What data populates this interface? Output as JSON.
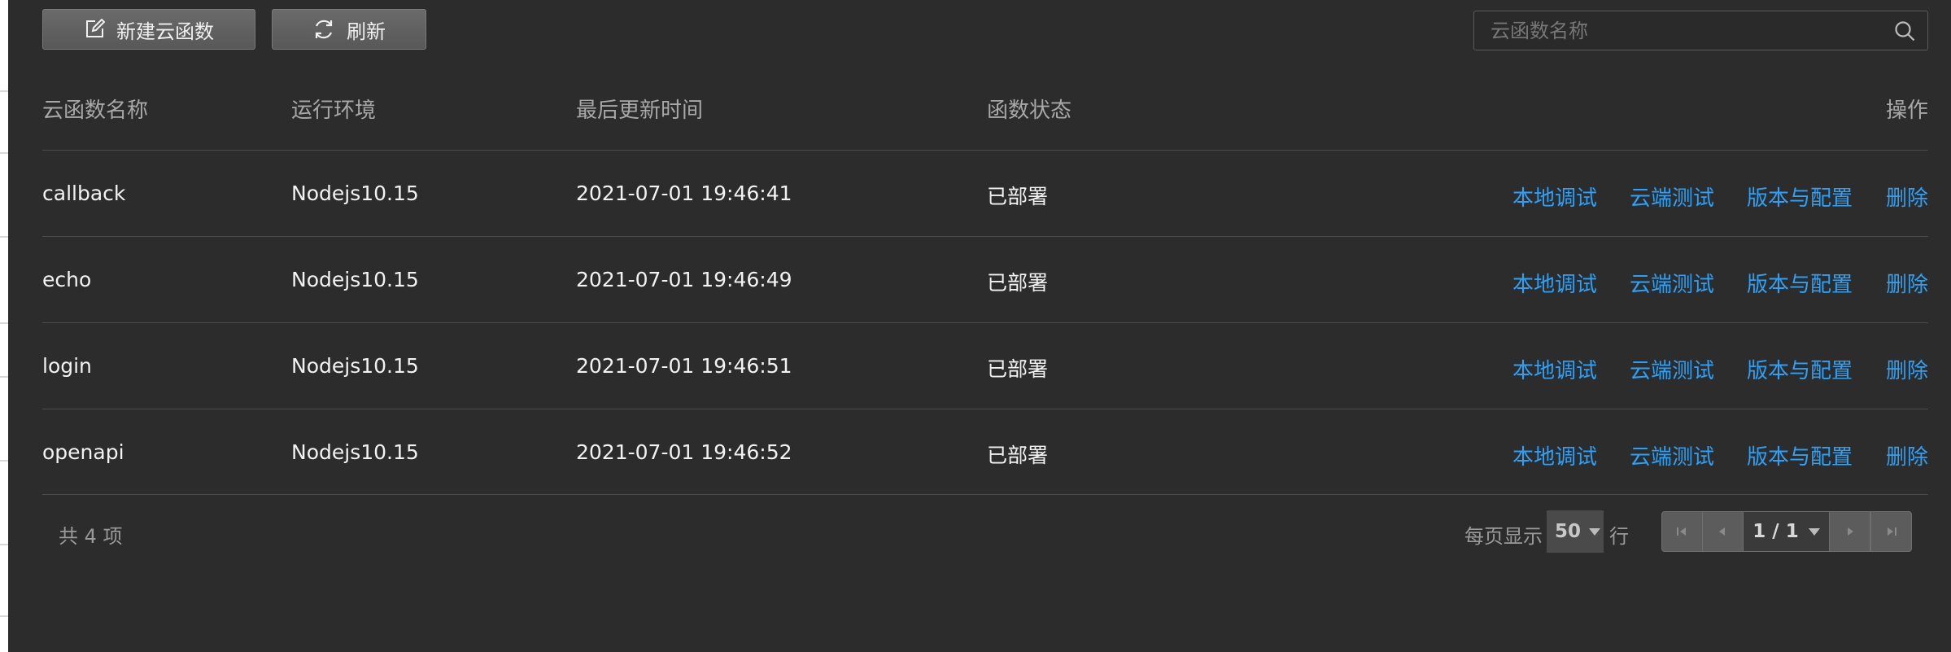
{
  "toolbar": {
    "new_label": "新建云函数",
    "refresh_label": "刷新",
    "search_placeholder": "云函数名称"
  },
  "table": {
    "headers": {
      "name": "云函数名称",
      "runtime": "运行环境",
      "updated": "最后更新时间",
      "status": "函数状态",
      "actions": "操作"
    },
    "rows": [
      {
        "name": "callback",
        "runtime": "Nodejs10.15",
        "updated": "2021-07-01 19:46:41",
        "status": "已部署"
      },
      {
        "name": "echo",
        "runtime": "Nodejs10.15",
        "updated": "2021-07-01 19:46:49",
        "status": "已部署"
      },
      {
        "name": "login",
        "runtime": "Nodejs10.15",
        "updated": "2021-07-01 19:46:51",
        "status": "已部署"
      },
      {
        "name": "openapi",
        "runtime": "Nodejs10.15",
        "updated": "2021-07-01 19:46:52",
        "status": "已部署"
      }
    ],
    "actions": {
      "local_debug": "本地调试",
      "cloud_test": "云端测试",
      "version_config": "版本与配置",
      "delete": "删除"
    }
  },
  "footer": {
    "total": "共 4 项",
    "per_page_prefix": "每页显示",
    "per_page_value": "50",
    "per_page_suffix": "行",
    "page_indicator": "1 / 1"
  },
  "colors": {
    "background": "#2c2c2c",
    "link": "#2ea0f6",
    "header_text": "#a8a8a8",
    "divider": "#4a4a4a"
  },
  "icons": [
    "edit-icon",
    "refresh-icon",
    "search-icon",
    "first-page-icon",
    "prev-page-icon",
    "next-page-icon",
    "last-page-icon",
    "dropdown-icon"
  ]
}
